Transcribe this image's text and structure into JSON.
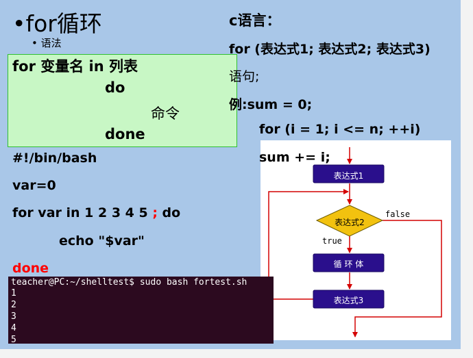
{
  "left": {
    "title": "•for循环",
    "subtitle": "• 语法",
    "syntax": [
      "for 变量名 in  列表",
      "do",
      "命令",
      "done"
    ],
    "code": [
      "#!/bin/bash",
      "var=0",
      "for var in 1 2 3 4 5 ",
      ";",
      " do",
      "echo \"$var\"",
      "done"
    ]
  },
  "terminal": {
    "command": "teacher@PC:~/shelltest$ sudo bash fortest.sh",
    "output": [
      "1",
      "2",
      "3",
      "4",
      "5"
    ],
    "colors": {
      "bg": "#2c0a1f",
      "fg": "#ffffff"
    }
  },
  "right": {
    "heading": "c语言：",
    "lines": [
      "for (表达式1; 表达式2; 表达式3)",
      "语句;",
      "例:sum = 0;",
      "for (i = 1; i <= n; ++i)",
      "sum += i;"
    ]
  },
  "flowchart": {
    "box1": "表达式1",
    "decision": "表达式2",
    "true_label": "true",
    "false_label": "false",
    "body": "循 环 体",
    "box3": "表达式3",
    "colors": {
      "box": "#2a0f8c",
      "decision": "#f2c20f",
      "arrow": "#d40000"
    }
  },
  "colors": {
    "slide_bg": "#a9c7e8",
    "green_box": "#c8f7c5",
    "accent_red": "#ff0000"
  }
}
